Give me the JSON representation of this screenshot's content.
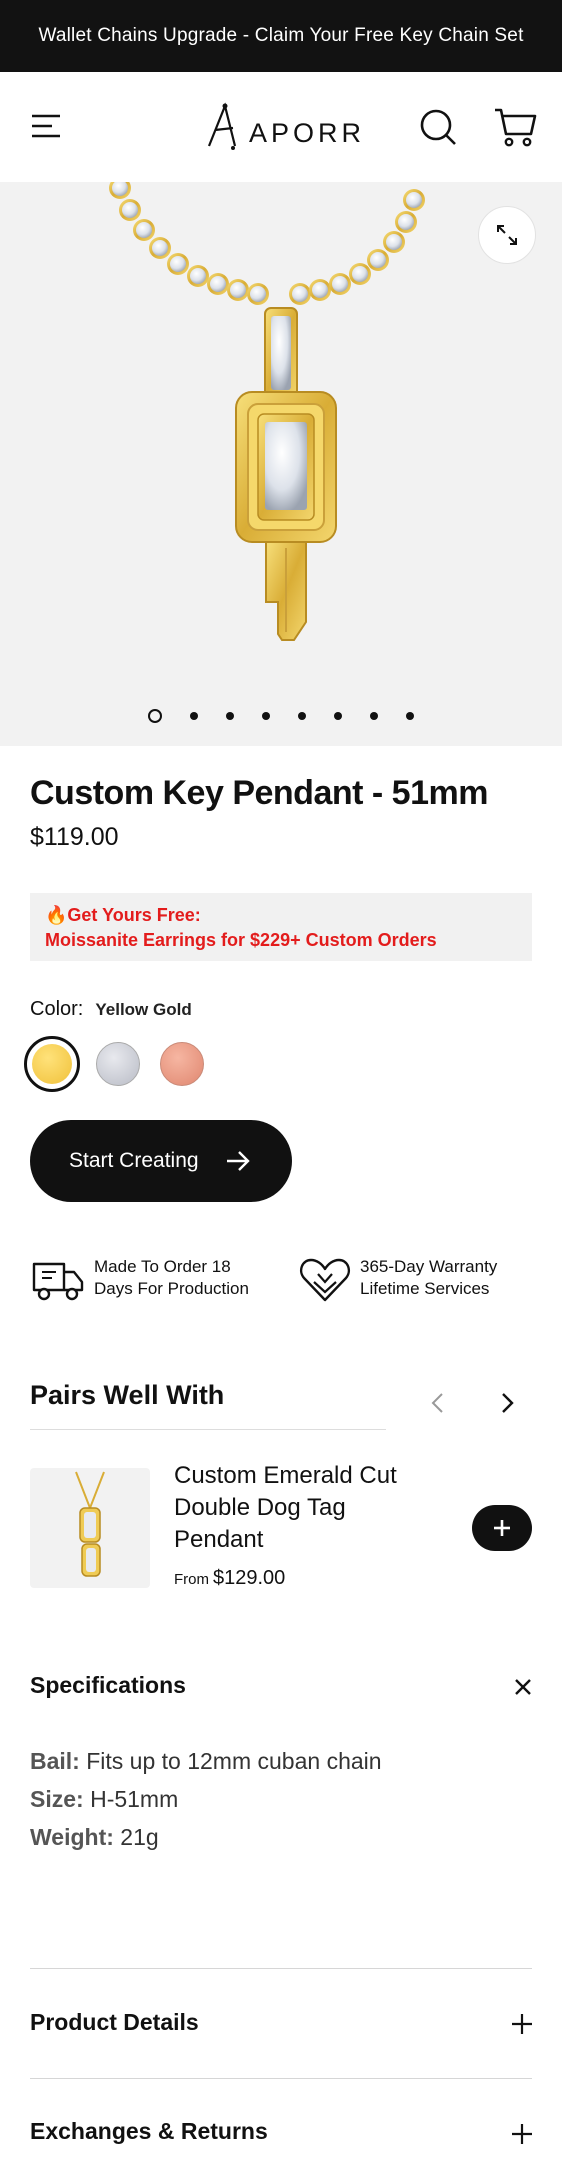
{
  "announcement": {
    "text": "Wallet Chains Upgrade - Claim Your Free Key Chain Set"
  },
  "header": {
    "logo_text": "APORRO",
    "icons": [
      "menu-icon",
      "search-icon",
      "cart-icon"
    ]
  },
  "gallery": {
    "slide_count": 9,
    "active_slide": 1,
    "expand_icon": "expand-icon"
  },
  "product": {
    "title": "Custom Key Pendant - 51mm",
    "price": "$119.00"
  },
  "promo": {
    "line1": "Get Yours Free:",
    "line2": "Moissanite Earrings for $229+ Custom Orders",
    "emoji": "🔥",
    "color": "#e31c1c"
  },
  "color_option": {
    "label": "Color:",
    "selected": "Yellow Gold",
    "swatches": [
      "Yellow Gold",
      "Silver",
      "Rose Gold"
    ]
  },
  "cta": {
    "label": "Start Creating"
  },
  "features": [
    {
      "icon": "delivery-truck-icon",
      "line1": "Made To Order 18",
      "line2": "Days For Production"
    },
    {
      "icon": "heart-hands-icon",
      "line1": "365-Day Warranty",
      "line2": "Lifetime Services"
    }
  ],
  "pairs": {
    "title": "Pairs Well With",
    "items": [
      {
        "name": "Custom Emerald Cut Double Dog Tag Pendant",
        "from_label": "From",
        "price": "$129.00"
      }
    ]
  },
  "specifications": {
    "title": "Specifications",
    "items": [
      {
        "label": "Bail:",
        "value": "Fits up to 12mm cuban chain"
      },
      {
        "label": "Size:",
        "value": "H-51mm"
      },
      {
        "label": "Weight:",
        "value": "21g"
      }
    ]
  },
  "accordions": [
    {
      "title": "Product Details"
    },
    {
      "title": "Exchanges & Returns"
    }
  ]
}
